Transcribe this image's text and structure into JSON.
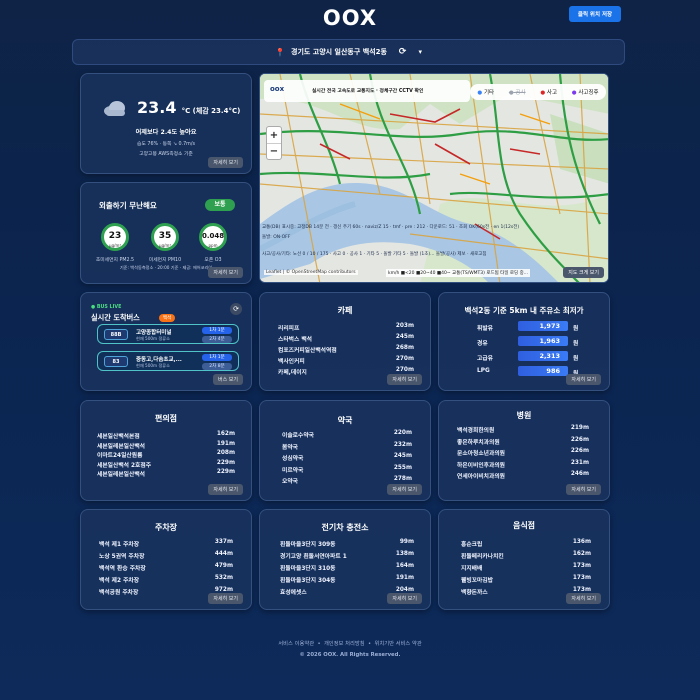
{
  "header": {
    "logo": "OOX",
    "save_button": "클릭 위치 저장"
  },
  "location": {
    "address": "경기도 고양시 일산동구 백석2동",
    "refresh_glyph": "⟳",
    "dropdown_glyph": "▾"
  },
  "weather": {
    "icon": "cloud-icon",
    "temp": "23.4",
    "unit_feel": "°C (체감 23.4°C)",
    "compare": "어제보다 2.4도 높아요",
    "details": "습도 76% · 동쪽 ↘ 0.7m/s",
    "station": "고양고봉 AWS측정소 기준",
    "more": "자세히 보기"
  },
  "air": {
    "title": "외출하기 무난해요",
    "badge": "보통",
    "pm25": {
      "value": "23",
      "unit": "μg/m³",
      "label": "초미세먼지 PM2.5"
    },
    "pm10": {
      "value": "35",
      "unit": "μg/m³",
      "label": "미세먼지 PM10"
    },
    "o3": {
      "value": "0.048",
      "unit": "ppm",
      "label": "오존 O3"
    },
    "basis": "기준: 백석동측정소 · 20:00 기준 · 제공: 에어코리아",
    "more": "자세히 보기"
  },
  "map": {
    "title": "실시간 전국 고속도로 교통지도 · 정체구간 CCTV 확인",
    "logo": "oox",
    "legend": [
      "기타",
      "공사",
      "사고",
      "사고징후"
    ],
    "legend_colors": [
      "#3b82f6",
      "#9ca3af",
      "#dc2626",
      "#7c3aed"
    ],
    "zoom_in": "+",
    "zoom_out": "−",
    "overlay1": "교통(DB) 표시중: 고정DB 14분 전 · 갱신 주기 60s · naviz/Z 15 · tmf · pre : 212 · 다운로드: 51 · 조회 OK(60s전 · en 1(12s전)",
    "overlay2": "돌발: ON·OFF",
    "overlay3": "사고/공사/기타: 노선 0 / 10 / 175 · 사고 0 · 공사 1 · 기타 5 · 돌발 기타 5 · 돌발 (1초)... 돌발(공사) 제보 · 새로고침",
    "attribution": "Leaflet | © OpenStreetMap contributors",
    "speed_legend": "km/h ■<20 ■20~40 ■40~ 교통(TS/WMT3) 로드됨 타일 로딩 중...",
    "more": "지도 크게 보기"
  },
  "bus": {
    "live": "BUS LIVE",
    "title": "실시간 도착버스",
    "tag": "백석",
    "items": [
      {
        "route": "88B",
        "name": "고양종합터미널",
        "sub": "현재 500m 정류소",
        "eta1": "1차 1분",
        "eta2": "2차 4분"
      },
      {
        "route": "83",
        "name": "중동고,다솜초교,...",
        "sub": "현재 500m 정류소",
        "eta1": "1차 1분",
        "eta2": "2차 8분"
      }
    ],
    "more": "버스 보기"
  },
  "cafe": {
    "title": "카페",
    "items": [
      {
        "name": "리리피프",
        "dist": "203m"
      },
      {
        "name": "스타벅스 백석",
        "dist": "245m"
      },
      {
        "name": "컴포즈커피일산백석역점",
        "dist": "268m"
      },
      {
        "name": "백사인커피",
        "dist": "270m"
      },
      {
        "name": "카페,데이지",
        "dist": "270m"
      }
    ],
    "more": "자세히 보기"
  },
  "fuel": {
    "title": "백석2동 기준 5km 내 주유소 최저가",
    "items": [
      {
        "name": "휘발유",
        "price": "1,973",
        "unit": "원"
      },
      {
        "name": "경유",
        "price": "1,963",
        "unit": "원"
      },
      {
        "name": "고급유",
        "price": "2,313",
        "unit": "원"
      },
      {
        "name": "LPG",
        "price": "986",
        "unit": "원"
      }
    ],
    "more": "자세히 보기"
  },
  "conv": {
    "title": "편의점",
    "items": [
      {
        "name": "세븐일산백석본점",
        "dist": "162m"
      },
      {
        "name": "세븐일레븐일산백석",
        "dist": "191m"
      },
      {
        "name": "이마트24일산원룸",
        "dist": "208m"
      },
      {
        "name": "세븐일산백석 2호점주",
        "dist": "229m"
      },
      {
        "name": "세븐일레븐일산백석",
        "dist": "229m"
      }
    ],
    "more": "자세히 보기"
  },
  "pharmacy": {
    "title": "약국",
    "items": [
      {
        "name": "이솔로수약국",
        "dist": "220m"
      },
      {
        "name": "봄약국",
        "dist": "232m"
      },
      {
        "name": "성심약국",
        "dist": "245m"
      },
      {
        "name": "미르약국",
        "dist": "255m"
      },
      {
        "name": "오약국",
        "dist": "278m"
      }
    ],
    "more": "자세히 보기"
  },
  "hospital": {
    "title": "병원",
    "items": [
      {
        "name": "백석경희한의원",
        "dist": "219m"
      },
      {
        "name": "좋은하루치과의원",
        "dist": "226m"
      },
      {
        "name": "문소아청소년과의원",
        "dist": "226m"
      },
      {
        "name": "하은이비인후과의원",
        "dist": "231m"
      },
      {
        "name": "연세아이비치과의원",
        "dist": "246m"
      }
    ],
    "more": "자세히 보기"
  },
  "parking": {
    "title": "주차장",
    "items": [
      {
        "name": "백석 제1 주차장",
        "dist": "337m"
      },
      {
        "name": "노상 5권역 주차장",
        "dist": "444m"
      },
      {
        "name": "백석역 환승 주차장",
        "dist": "479m"
      },
      {
        "name": "백석 제2 주차장",
        "dist": "532m"
      },
      {
        "name": "백석공원 주차장",
        "dist": "972m"
      }
    ],
    "more": "자세히 보기"
  },
  "ev": {
    "title": "전기차 충전소",
    "items": [
      {
        "name": "흰돌마을3단지 309동",
        "dist": "99m"
      },
      {
        "name": "경기고양 흰돌서연아파트 1",
        "dist": "138m"
      },
      {
        "name": "흰돌마을3단지 310동",
        "dist": "164m"
      },
      {
        "name": "흰돌마을3단지 304동",
        "dist": "191m"
      },
      {
        "name": "효성에셋스",
        "dist": "204m"
      }
    ],
    "more": "자세히 보기"
  },
  "food": {
    "title": "음식점",
    "items": [
      {
        "name": "홍순크립",
        "dist": "136m"
      },
      {
        "name": "흰돌페리카나치킨",
        "dist": "162m"
      },
      {
        "name": "지지배배",
        "dist": "173m"
      },
      {
        "name": "웰빙꼬마김밥",
        "dist": "173m"
      },
      {
        "name": "백향돈까스",
        "dist": "173m"
      }
    ],
    "more": "자세히 보기"
  },
  "footer": {
    "links": [
      "서비스 이용약관",
      "개인정보 처리방침",
      "위치기반 서비스 약관"
    ],
    "separator": "•",
    "copyright": "© 2026 OOX. All Rights Reserved."
  }
}
